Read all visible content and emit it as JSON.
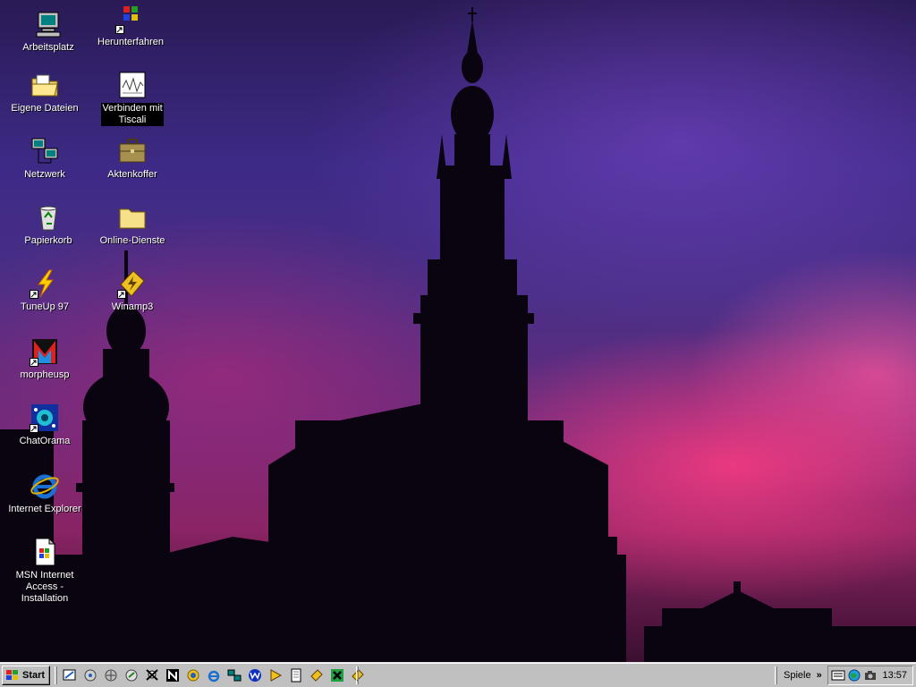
{
  "desktop": {
    "icons": [
      {
        "label": "Arbeitsplatz",
        "icon": "my-computer-icon",
        "shortcut": false
      },
      {
        "label": "Herunterfahren",
        "icon": "shutdown-windows-icon",
        "shortcut": true
      },
      {
        "label": "Eigene Dateien",
        "icon": "my-documents-folder-icon",
        "shortcut": false
      },
      {
        "label": "Verbinden mit\nTiscali",
        "icon": "dial-up-connection-icon",
        "shortcut": false
      },
      {
        "label": "Netzwerk",
        "icon": "network-neighborhood-icon",
        "shortcut": false
      },
      {
        "label": "Aktenkoffer",
        "icon": "briefcase-icon",
        "shortcut": false
      },
      {
        "label": "Papierkorb",
        "icon": "recycle-bin-icon",
        "shortcut": false
      },
      {
        "label": "Online-Dienste",
        "icon": "folder-icon",
        "shortcut": false
      },
      {
        "label": "TuneUp 97",
        "icon": "tuneup-lightning-icon",
        "shortcut": true
      },
      {
        "label": "Winamp3",
        "icon": "winamp-icon",
        "shortcut": true
      },
      {
        "label": "morpheusp",
        "icon": "morpheus-icon",
        "shortcut": true
      },
      {
        "label": "ChatOrama",
        "icon": "chatorama-icon",
        "shortcut": true
      },
      {
        "label": "Internet Explorer",
        "icon": "internet-explorer-icon",
        "shortcut": false
      },
      {
        "label": "MSN Internet\nAccess - Installation",
        "icon": "msn-setup-icon",
        "shortcut": false
      }
    ]
  },
  "taskbar": {
    "start_label": "Start",
    "quicklaunch": [
      "show-desktop-icon",
      "outlook-express-icon",
      "internet-icon",
      "connection-icon",
      "pirate-skull-icon",
      "n-app-icon",
      "sun-gear-icon",
      "internet-explorer-icon",
      "network-icon",
      "w-app-icon",
      "media-player-icon",
      "notepad-icon",
      "winamp-icon",
      "kazaa-icon",
      "winamp-icon"
    ],
    "toolbar_label": "Spiele",
    "toolbar_chevron": "»",
    "tray_icons": [
      "isdn-icon",
      "globe-icon",
      "camera-icon"
    ],
    "clock": "13:57"
  },
  "colors": {
    "taskbar": "#c0c0c0",
    "selection": "#000000",
    "label_text": "#ffffff"
  }
}
